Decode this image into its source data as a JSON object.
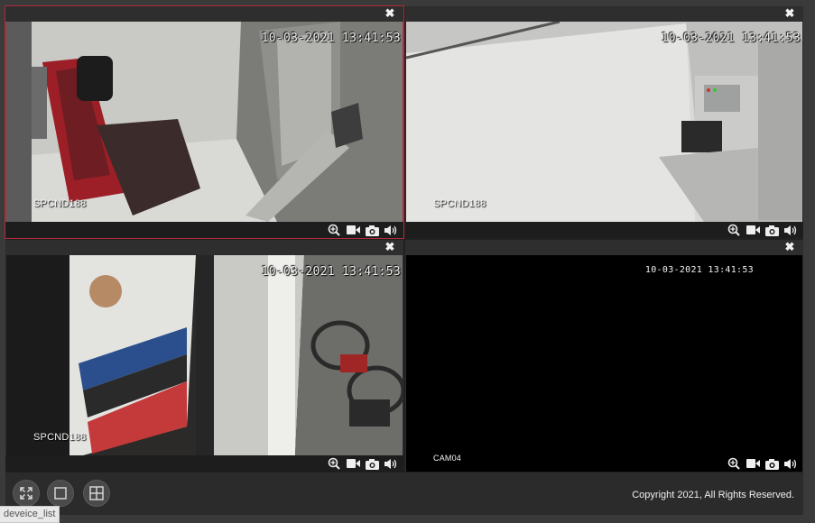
{
  "cameras": [
    {
      "id": "cam1",
      "timestamp": "10-03-2021 13:41:53",
      "label": "SPCND188"
    },
    {
      "id": "cam2",
      "timestamp": "10-03-2021 13:41:53",
      "label": "SPCND188"
    },
    {
      "id": "cam3",
      "timestamp": "10-03-2021 13:41:53",
      "label": "SPCND188"
    },
    {
      "id": "cam4",
      "timestamp": "10-03-2021 13:41:53",
      "label": "CAM04"
    }
  ],
  "close_glyph": "✖",
  "footer": {
    "copyright": "Copyright 2021, All Rights Reserved."
  },
  "tooltip": "deveice_list",
  "colors": {
    "selected_border": "#b22b3a",
    "bar": "#2e2e2e",
    "footer": "#2b2b2b"
  }
}
